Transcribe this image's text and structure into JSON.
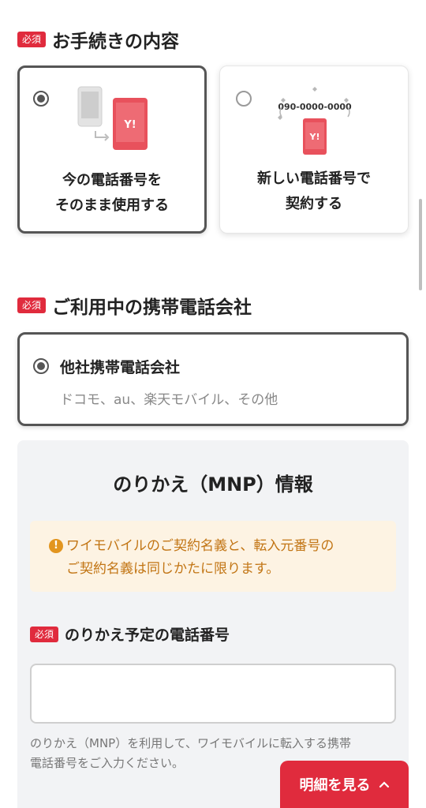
{
  "procedure": {
    "required_badge": "必須",
    "title": "お手続きの内容",
    "options": [
      {
        "line1": "今の電話番号を",
        "line2": "そのまま使用する",
        "selected": true
      },
      {
        "line1": "新しい電話番号で",
        "line2": "契約する",
        "selected": false
      }
    ],
    "phone_number_sample": "090-0000-0000",
    "phone_logo": "Y!"
  },
  "carrier": {
    "required_badge": "必須",
    "title": "ご利用中の携帯電話会社",
    "option": {
      "title": "他社携帯電話会社",
      "subtitle": "ドコモ、au、楽天モバイル、その他",
      "selected": true
    }
  },
  "mnp": {
    "title": "のりかえ（MNP）情報",
    "notice_line1": "ワイモバイルのご契約名義と、転入元番号の",
    "notice_line2": "ご契約名義は同じかたに限ります。",
    "notice_icon": "warning-icon",
    "field": {
      "required_badge": "必須",
      "label": "のりかえ予定の電話番号",
      "value": "",
      "placeholder": ""
    },
    "help_line1": "のりかえ（MNP）を利用して、ワイモバイルに転入する携帯",
    "help_line2": "電話番号をご入力ください。"
  },
  "details_button": {
    "label": "明細を見る",
    "icon": "chevron-up-icon"
  },
  "colors": {
    "accent_red": "#e02b3d",
    "notice_bg": "#fdf3e3",
    "notice_text": "#c27514",
    "panel_bg": "#f2f3f5"
  }
}
